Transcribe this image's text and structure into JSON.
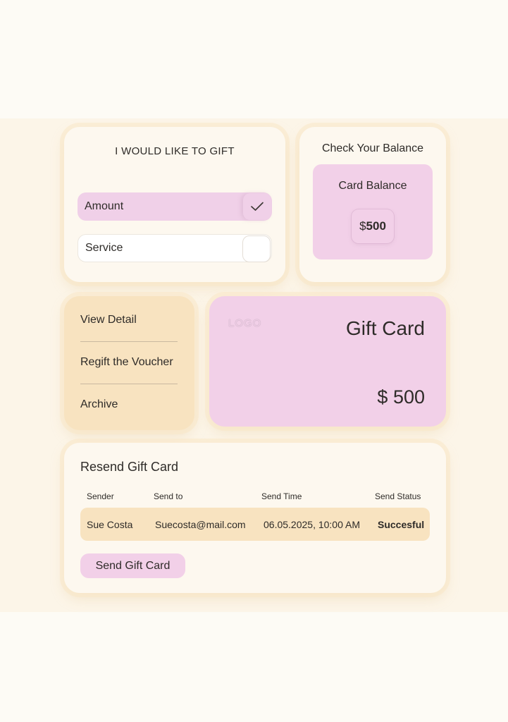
{
  "gift_selector": {
    "title": "I WOULD LIKE TO GIFT",
    "options": [
      {
        "label": "Amount",
        "selected": true
      },
      {
        "label": "Service",
        "selected": false
      }
    ]
  },
  "balance": {
    "title": "Check Your Balance",
    "card_label": "Card Balance",
    "currency": "$",
    "amount": "500"
  },
  "actions_menu": {
    "items": [
      "View Detail",
      "Regift the Voucher",
      "Archive"
    ]
  },
  "gift_card_preview": {
    "logo": "LOGO",
    "title": "Gift Card",
    "amount": "$ 500"
  },
  "resend": {
    "title": "Resend Gift Card",
    "columns": [
      "Sender",
      "Send to",
      "Send Time",
      "Send Status"
    ],
    "rows": [
      {
        "sender": "Sue Costa",
        "send_to": "Suecosta@mail.com",
        "send_time": "06.05.2025, 10:00 AM",
        "status": "Succesful"
      }
    ],
    "button_label": "Send Gift Card"
  },
  "colors": {
    "pink": "#f2d0e8",
    "peach": "#f8e3c0",
    "cream": "#fdf8ef",
    "text": "#2e2b28"
  },
  "icons": {
    "selected_check": "checkmark-icon"
  }
}
